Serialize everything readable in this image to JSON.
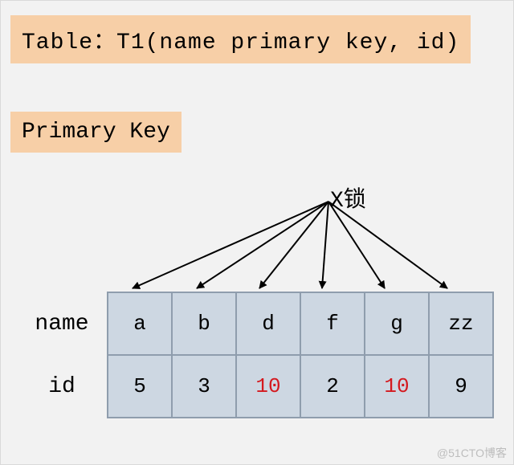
{
  "title": "Table：T1(name primary key, id)",
  "primary_key_label": "Primary Key",
  "lock_label": "X锁",
  "row_headers": {
    "name": "name",
    "id": "id"
  },
  "columns": [
    {
      "name": "a",
      "id": "5",
      "id_highlight": false
    },
    {
      "name": "b",
      "id": "3",
      "id_highlight": false
    },
    {
      "name": "d",
      "id": "10",
      "id_highlight": true
    },
    {
      "name": "f",
      "id": "2",
      "id_highlight": false
    },
    {
      "name": "g",
      "id": "10",
      "id_highlight": true
    },
    {
      "name": "zz",
      "id": "9",
      "id_highlight": false
    }
  ],
  "watermark": "@51CTO博客"
}
